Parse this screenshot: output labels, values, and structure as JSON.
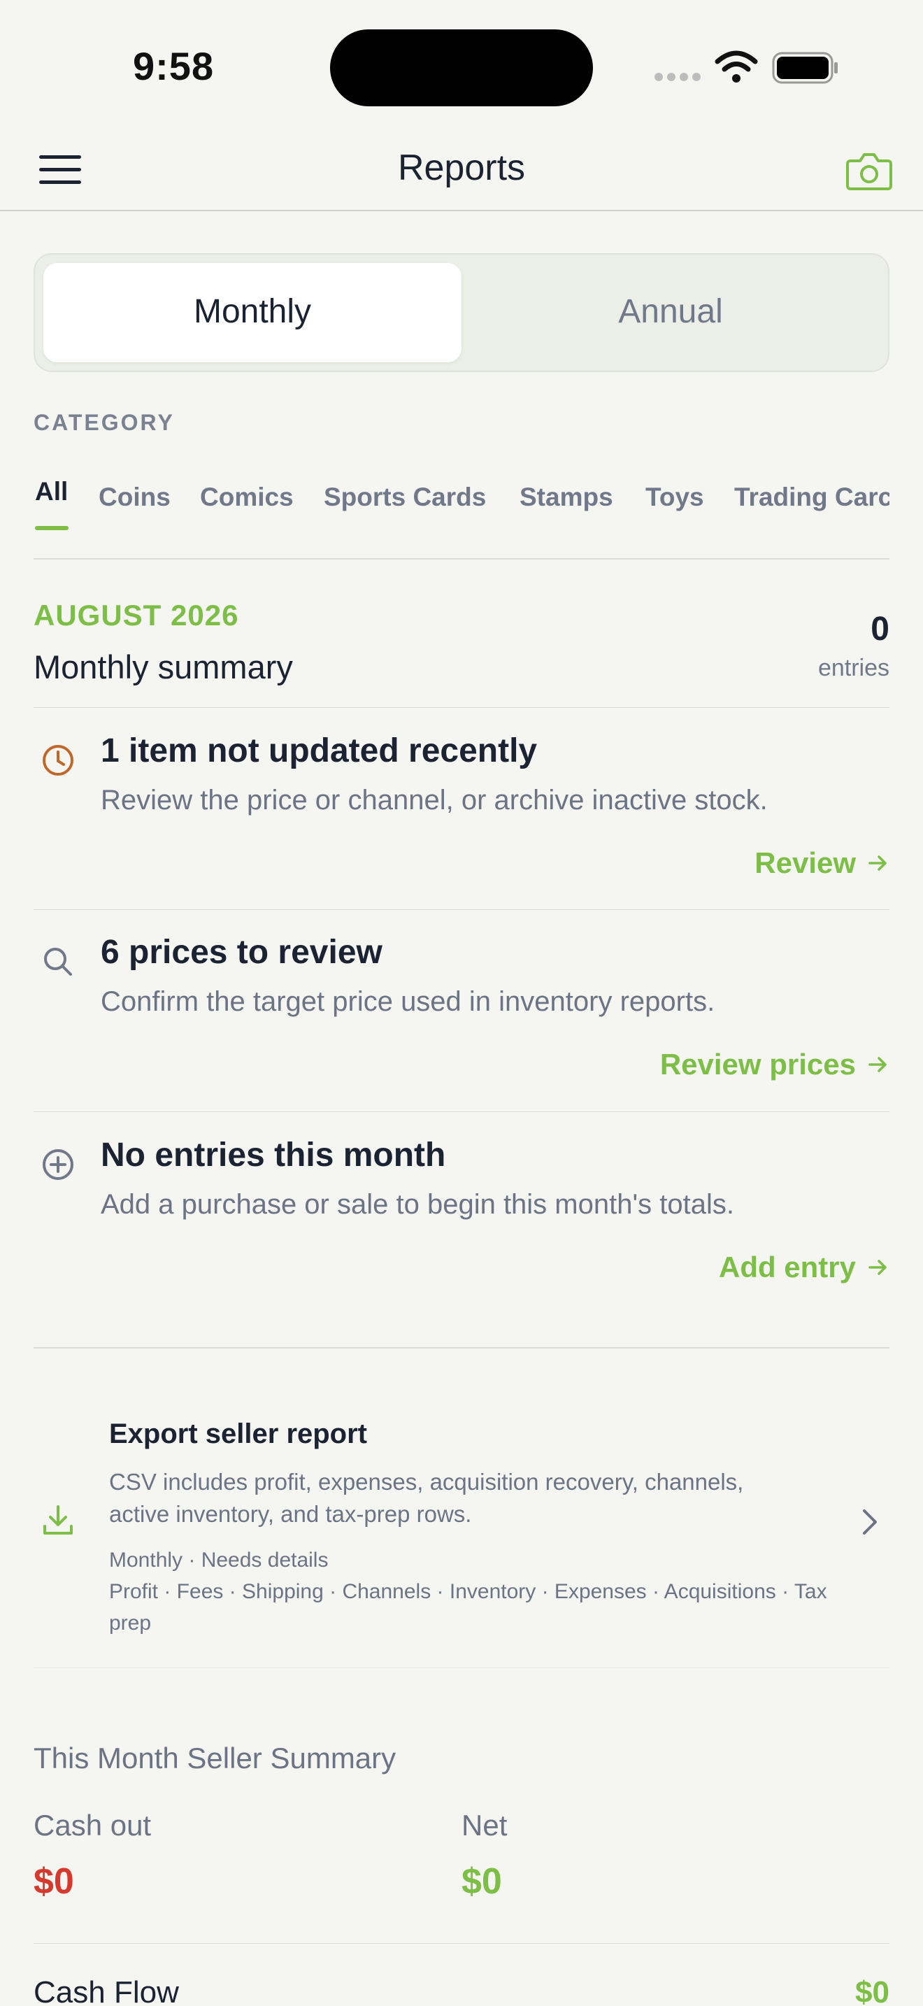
{
  "status_bar": {
    "time": "9:58"
  },
  "header": {
    "title": "Reports"
  },
  "segments": {
    "monthly": "Monthly",
    "annual": "Annual"
  },
  "category": {
    "label": "CATEGORY",
    "tabs": [
      "All",
      "Coins",
      "Comics",
      "Sports Cards",
      "Stamps",
      "Toys",
      "Trading Carc"
    ]
  },
  "summary": {
    "month": "AUGUST 2026",
    "title": "Monthly summary",
    "entries_count": "0",
    "entries_label": "entries"
  },
  "alerts": [
    {
      "icon": "clock-icon",
      "title": "1 item not updated recently",
      "desc": "Review the price or channel, or archive inactive stock.",
      "link": "Review"
    },
    {
      "icon": "search-icon",
      "title": "6 prices to review",
      "desc": "Confirm the target price used in inventory reports.",
      "link": "Review prices"
    },
    {
      "icon": "plus-circle-icon",
      "title": "No entries this month",
      "desc": "Add a purchase or sale to begin this month's totals.",
      "link": "Add entry"
    }
  ],
  "export": {
    "title": "Export seller report",
    "desc": "CSV includes profit, expenses, acquisition recovery, channels, active inventory, and tax-prep rows.",
    "meta1": "Monthly · Needs details",
    "meta2": "Profit · Fees · Shipping · Channels · Inventory · Expenses · Acquisitions · Tax prep"
  },
  "seller_summary": {
    "title": "This Month Seller Summary",
    "cash_out_label": "Cash out",
    "cash_out_value": "$0",
    "net_label": "Net",
    "net_value": "$0",
    "cash_flow_label": "Cash Flow",
    "cash_flow_value": "$0"
  },
  "colors": {
    "accent": "#7dbe47",
    "negative": "#d63a2f",
    "warning": "#c0672a"
  }
}
